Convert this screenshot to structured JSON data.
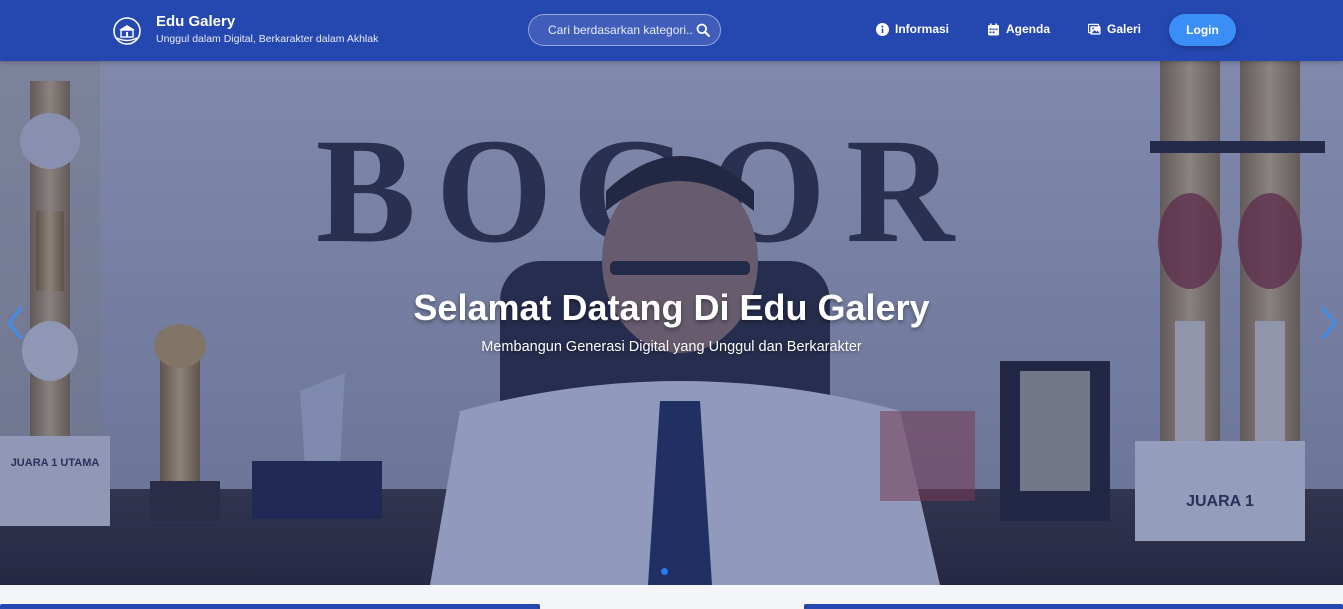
{
  "brand": {
    "title": "Edu Galery",
    "subtitle": "Unggul dalam Digital, Berkarakter dalam Akhlak",
    "logo_icon": "school-logo-icon"
  },
  "search": {
    "placeholder": "Cari berdasarkan kategori...",
    "icon": "search-icon"
  },
  "nav": {
    "items": [
      {
        "label": "Informasi",
        "icon": "info-icon"
      },
      {
        "label": "Agenda",
        "icon": "calendar-icon"
      },
      {
        "label": "Galeri",
        "icon": "image-icon"
      }
    ],
    "login_label": "Login"
  },
  "hero": {
    "title": "Selamat Datang Di Edu Galery",
    "subtitle": "Membangun Generasi Digital yang Unggul dan Berkarakter",
    "background_text": "BOGOR",
    "trophy_plaque_left": "JUARA 1 UTAMA",
    "trophy_plaque_right": "JUARA 1",
    "active_slide": 1,
    "slide_count": 1
  },
  "colors": {
    "navbar": "#2547b0",
    "accent": "#3a8ef6",
    "overlay": "#283778",
    "text": "#ffffff"
  }
}
